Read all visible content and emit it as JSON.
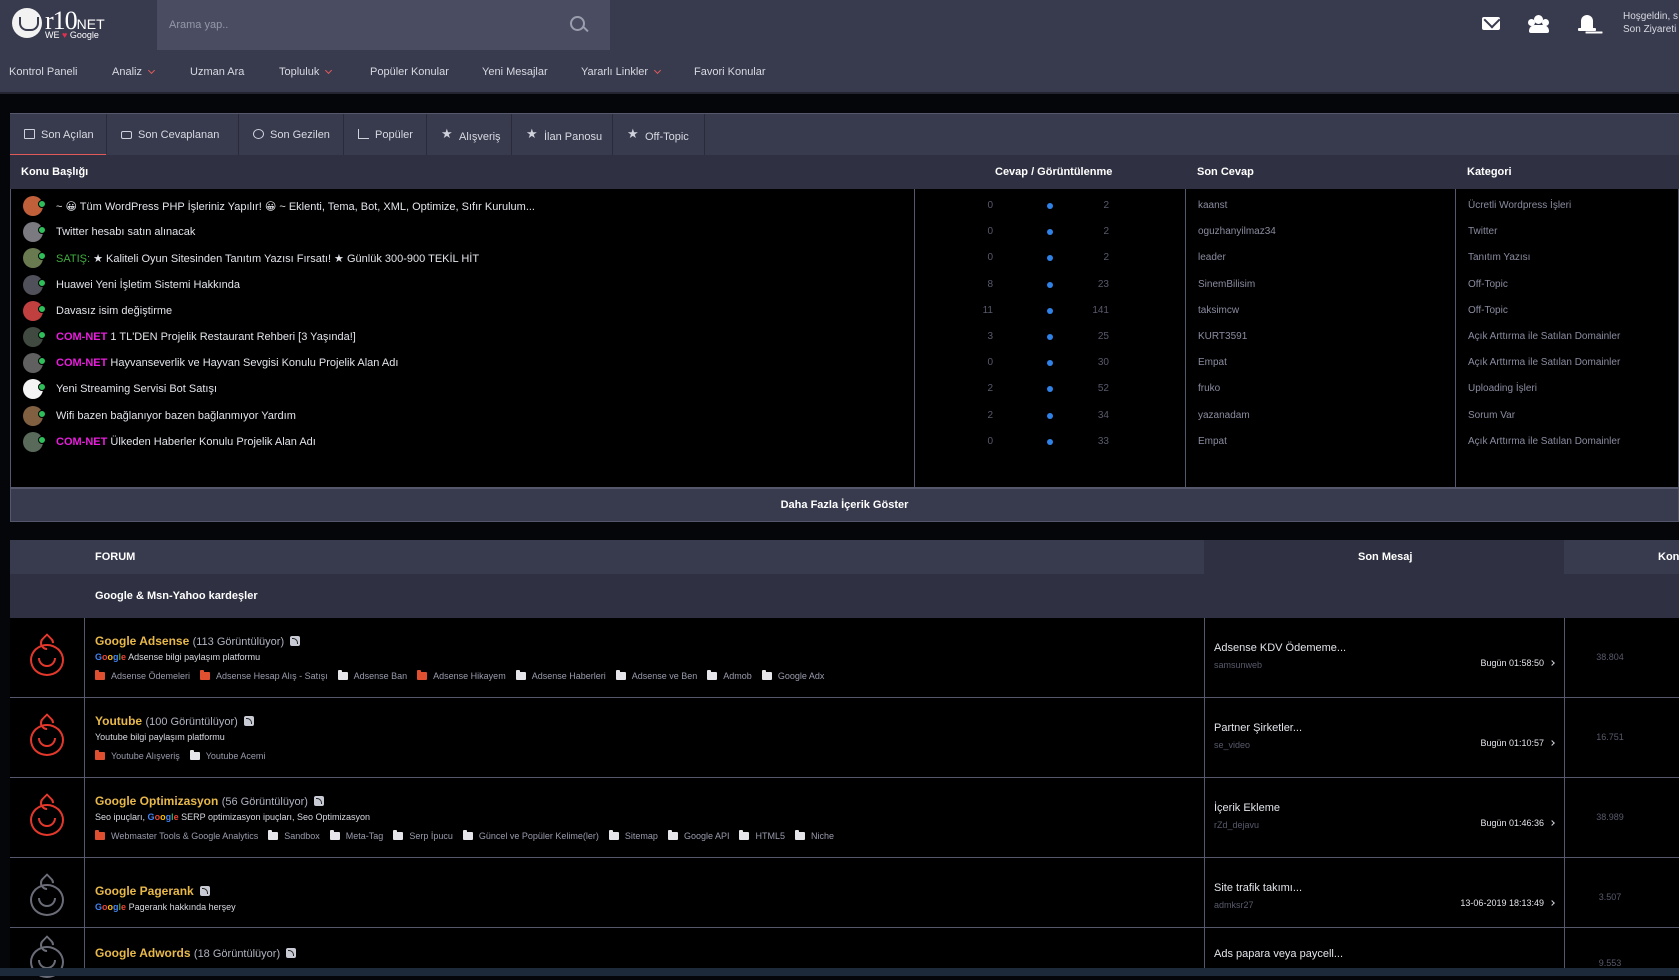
{
  "header": {
    "logo": {
      "brand": "r10",
      "brand_suffix": "NET",
      "sub_left": "WE",
      "sub_right": "Google"
    },
    "search": {
      "placeholder": "Arama yap.."
    },
    "welcome_line1": "Hoşgeldin, s",
    "welcome_line2": "Son Ziyareti"
  },
  "nav": {
    "items": [
      {
        "label": "Kontrol Paneli"
      },
      {
        "label": "Analiz"
      },
      {
        "label": "Uzman Ara"
      },
      {
        "label": "Topluluk"
      },
      {
        "label": "Popüler Konular"
      },
      {
        "label": "Yeni Mesajlar"
      },
      {
        "label": "Yararlı Linkler"
      },
      {
        "label": "Favori Konular"
      }
    ]
  },
  "tabs": [
    {
      "label": "Son Açılan",
      "icon": "document-icon"
    },
    {
      "label": "Son Cevaplanan",
      "icon": "chat-icon"
    },
    {
      "label": "Son Gezilen",
      "icon": "history-icon"
    },
    {
      "label": "Popüler",
      "icon": "trend-icon"
    },
    {
      "label": "Alışveriş",
      "icon": "star-icon"
    },
    {
      "label": "İlan Panosu",
      "icon": "star-icon"
    },
    {
      "label": "Off-Topic",
      "icon": "star-icon"
    }
  ],
  "topics_header": {
    "title": "Konu Başlığı",
    "stats": "Cevap / Görüntülenme",
    "last": "Son Cevap",
    "category": "Kategori"
  },
  "topics": [
    {
      "prefix": "",
      "title": "~ 😀 Tüm WordPress PHP İşleriniz Yapılır! 😀 ~ Eklenti, Tema, Bot, XML, Optimize, Sıfır Kurulum...",
      "replies": "0",
      "views": "2",
      "user": "kaanst",
      "category": "Ücretli Wordpress İşleri"
    },
    {
      "prefix": "",
      "title": "Twitter hesabı satın alınacak",
      "replies": "0",
      "views": "2",
      "user": "oguzhanyilmaz34",
      "category": "Twitter"
    },
    {
      "prefix": "SATIŞ:",
      "title": "★ Kaliteli Oyun Sitesinden Tanıtım Yazısı Fırsatı! ★ Günlük 300-900 TEKİL HİT",
      "replies": "0",
      "views": "2",
      "user": "leader",
      "category": "Tanıtım Yazısı"
    },
    {
      "prefix": "",
      "title": "Huawei Yeni İşletim Sistemi Hakkında",
      "replies": "8",
      "views": "23",
      "user": "SinemBilisim",
      "category": "Off-Topic"
    },
    {
      "prefix": "",
      "title": "Davasız isim değiştirme",
      "replies": "11",
      "views": "141",
      "user": "taksimcw",
      "category": "Off-Topic"
    },
    {
      "prefix": "COM-NET",
      "title": "1 TL'DEN Projelik Restaurant Rehberi [3 Yaşında!]",
      "replies": "3",
      "views": "25",
      "user": "KURT3591",
      "category": "Açık Arttırma ile Satılan Domainler"
    },
    {
      "prefix": "COM-NET",
      "title": "Hayvanseverlik ve Hayvan Sevgisi Konulu Projelik Alan Adı",
      "replies": "0",
      "views": "30",
      "user": "Empat",
      "category": "Açık Arttırma ile Satılan Domainler"
    },
    {
      "prefix": "",
      "title": "Yeni Streaming Servisi Bot Satışı",
      "replies": "2",
      "views": "52",
      "user": "fruko",
      "category": "Uploading İşleri"
    },
    {
      "prefix": "",
      "title": "Wifi bazen bağlanıyor bazen bağlanmıyor Yardım",
      "replies": "2",
      "views": "34",
      "user": "yazanadam",
      "category": "Sorum Var"
    },
    {
      "prefix": "COM-NET",
      "title": "Ülkeden Haberler Konulu Projelik Alan Adı",
      "replies": "0",
      "views": "33",
      "user": "Empat",
      "category": "Açık Arttırma ile Satılan Domainler"
    }
  ],
  "more_button": "Daha Fazla İçerik Göster",
  "forum_header": {
    "forum": "FORUM",
    "last": "Son Mesaj",
    "count": "Kon"
  },
  "section_title": "Google & Msn-Yahoo kardeşler",
  "forums": [
    {
      "name": "Google Adsense",
      "views": "(113 Görüntülüyor)",
      "desc_google": true,
      "desc": "Adsense bilgi paylaşım platformu",
      "subs": [
        "Adsense Ödemeleri",
        "Adsense Hesap Alış - Satışı",
        "Adsense Ban",
        "Adsense Hikayem",
        "Adsense Haberleri",
        "Adsense ve Ben",
        "Admob",
        "Google Adx"
      ],
      "last_title": "Adsense KDV Ödememe...",
      "last_user": "samsunweb",
      "last_date": "Bugün 01:58:50",
      "count": "38.804"
    },
    {
      "name": "Youtube",
      "views": "(100 Görüntülüyor)",
      "desc_google": false,
      "desc": "Youtube bilgi paylaşım platformu",
      "subs": [
        "Youtube Alışveriş",
        "Youtube Acemi"
      ],
      "last_title": "Partner Şirketler...",
      "last_user": "se_video",
      "last_date": "Bugün 01:10:57",
      "count": "16.751"
    },
    {
      "name": "Google Optimizasyon",
      "views": "(56 Görüntülüyor)",
      "desc_pre": "Seo ipuçları,",
      "desc": "SERP optimizasyon ipuçları, Seo Optimizasyon",
      "subs": [
        "Webmaster Tools & Google Analytics",
        "Sandbox",
        "Meta-Tag",
        "Serp İpucu",
        "Güncel ve Popüler Kelime(ler)",
        "Sitemap",
        "Google API",
        "HTML5",
        "Niche"
      ],
      "last_title": "İçerik Ekleme",
      "last_user": "rZd_dejavu",
      "last_date": "Bugün 01:46:36",
      "count": "38.989"
    },
    {
      "name": "Google Pagerank",
      "views": "",
      "desc_google": true,
      "desc": "Pagerank hakkında herşey",
      "subs": [],
      "last_title": "Site trafik takımı...",
      "last_user": "admksr27",
      "last_date": "13-06-2019 18:13:49",
      "count": "3.507"
    },
    {
      "name": "Google Adwords",
      "views": "(18 Görüntülüyor)",
      "last_title": "Ads papara veya paycell...",
      "count": "9.553"
    }
  ],
  "google_word": [
    "G",
    "o",
    "o",
    "g",
    "l",
    "e"
  ],
  "colors": {
    "accent": "#e05a5a",
    "forum_name": "#e8b94a",
    "com_net": "#e81edc",
    "satis": "#3fae3f",
    "dot": "#2f82e8"
  }
}
